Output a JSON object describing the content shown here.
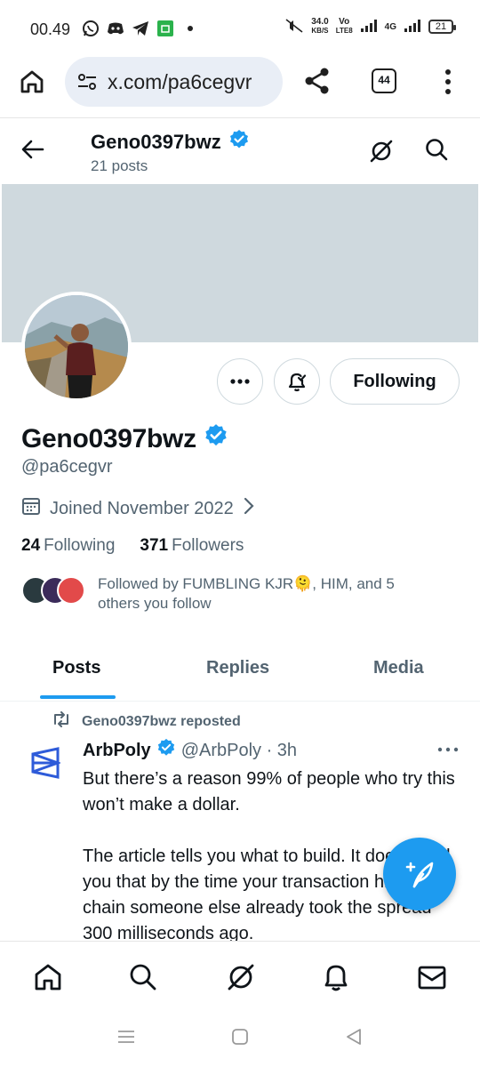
{
  "status": {
    "time": "00.49",
    "net_speed_value": "34.0",
    "net_speed_unit": "KB/S",
    "volte_top": "Vo",
    "volte_bottom": "LTE8",
    "network": "4G",
    "battery": "21"
  },
  "browser": {
    "url": "x.com/pa6cegvr",
    "tabs_count": "44"
  },
  "header": {
    "name": "Geno0397bwz",
    "posts_count": "21 posts"
  },
  "profile": {
    "display_name": "Geno0397bwz",
    "handle": "@pa6cegvr",
    "joined": "Joined November 2022",
    "following_count": "24",
    "following_label": "Following",
    "followers_count": "371",
    "followers_label": "Followers",
    "followed_by": "Followed by FUMBLING KJR🫠, HIM, and 5 others you follow",
    "following_button": "Following"
  },
  "tabs": [
    {
      "label": "Posts"
    },
    {
      "label": "Replies"
    },
    {
      "label": "Media"
    }
  ],
  "post": {
    "repost_label": "Geno0397bwz reposted",
    "author": "ArbPoly",
    "meta": "@ArbPoly · 3h",
    "paragraph1": "But there’s a reason 99% of people who try this won’t make a dollar.",
    "paragraph2": "The article tells you what to build. It doesn’t tell you that by the time your transaction hits the chain someone else already took the spread 300 milliseconds ago."
  },
  "colors": {
    "accent": "#1d9bf0",
    "muted": "#536471",
    "banner": "#cfd9de"
  }
}
